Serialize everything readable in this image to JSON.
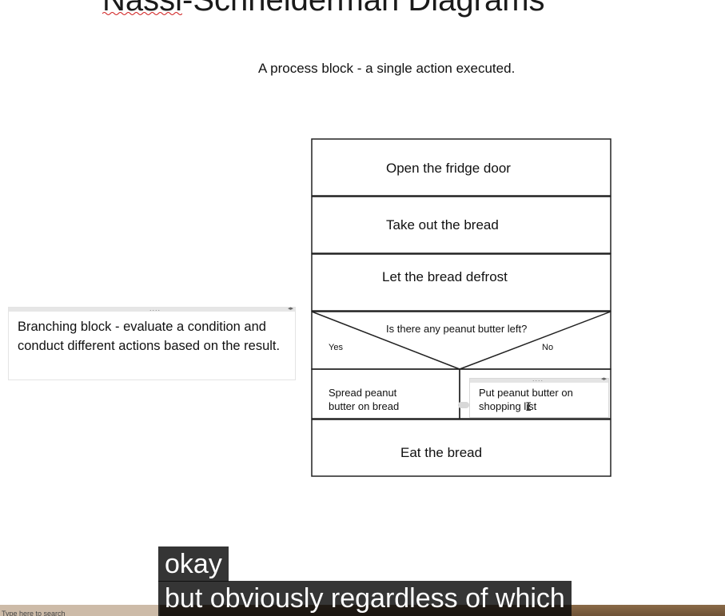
{
  "slide": {
    "title": "Nassi-Schneiderman Diagrams",
    "process_caption": "A process block - a single action executed.",
    "branch_caption": "Branching block - evaluate a condition and conduct different actions based on the result."
  },
  "diagram": {
    "blocks": [
      "Open the fridge door",
      "Take out the bread",
      "Let the bread defrost"
    ],
    "condition": "Is there any peanut butter left?",
    "yes_label": "Yes",
    "no_label": "No",
    "yes_action": "Spread peanut butter on bread",
    "no_action": "Put peanut butter on shopping list",
    "final_block": "Eat the bread"
  },
  "subtitles": {
    "line1": "okay",
    "line2": "but obviously regardless of which"
  },
  "taskbar": {
    "search_text": "Type here to search"
  },
  "colors": {
    "subtitle_bg": "#080808",
    "taskbar": "#7a5c3e"
  }
}
